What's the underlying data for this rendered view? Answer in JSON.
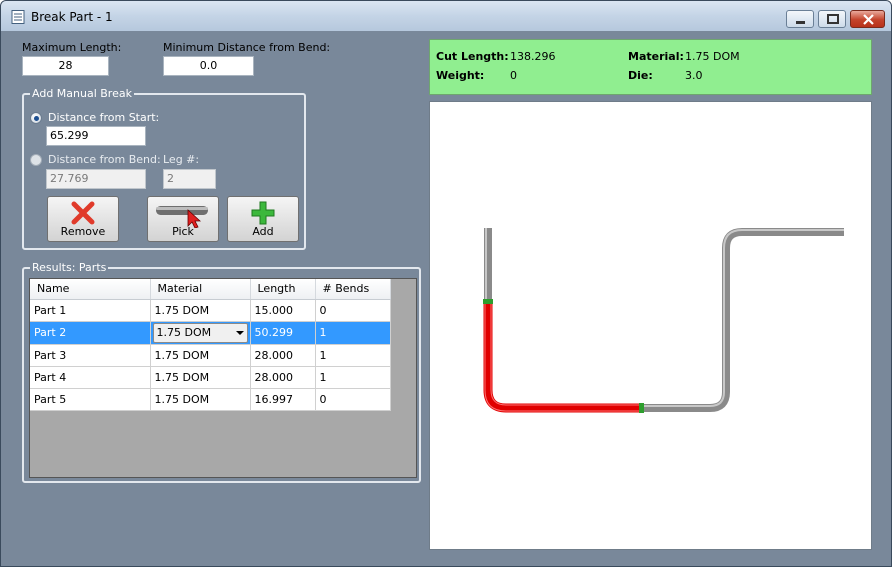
{
  "window": {
    "title": "Break Part - 1",
    "controls": [
      "minimize",
      "maximize",
      "close"
    ]
  },
  "settings": {
    "max_length_label": "Maximum Length:",
    "max_length_value": "28",
    "min_distance_label": "Minimum Distance from Bend:",
    "min_distance_value": "0.0"
  },
  "manual_break": {
    "group_title": "Add Manual Break",
    "distance_from_start_label": "Distance from Start:",
    "distance_from_start_value": "65.299",
    "distance_from_start_selected": true,
    "distance_from_bend_label": "Distance from Bend:",
    "distance_from_bend_value": "27.769",
    "leg_label": "Leg #:",
    "leg_value": "2",
    "buttons": {
      "remove": "Remove",
      "pick": "Pick",
      "add": "Add"
    }
  },
  "results": {
    "group_title": "Results: Parts",
    "columns": [
      "Name",
      "Material",
      "Length",
      "# Bends"
    ],
    "rows": [
      {
        "name": "Part 1",
        "material": "1.75 DOM",
        "length": "15.000",
        "bends": "0"
      },
      {
        "name": "Part 2",
        "material": "1.75 DOM",
        "length": "50.299",
        "bends": "1",
        "selected": true
      },
      {
        "name": "Part 3",
        "material": "1.75 DOM",
        "length": "28.000",
        "bends": "1"
      },
      {
        "name": "Part 4",
        "material": "1.75 DOM",
        "length": "28.000",
        "bends": "1"
      },
      {
        "name": "Part 5",
        "material": "1.75 DOM",
        "length": "16.997",
        "bends": "0"
      }
    ]
  },
  "info": {
    "cut_length_label": "Cut Length:",
    "cut_length_value": "138.296",
    "weight_label": "Weight:",
    "weight_value": "0",
    "material_label": "Material:",
    "material_value": "1.75 DOM",
    "die_label": "Die:",
    "die_value": "3.0",
    "background": "#90ee90"
  },
  "colors": {
    "client_bg": "#79889a",
    "selection": "#3399ff",
    "tube_gray": "#8a8a8a",
    "tube_highlight": "#e00000",
    "break_marker": "#2e9e2e"
  }
}
